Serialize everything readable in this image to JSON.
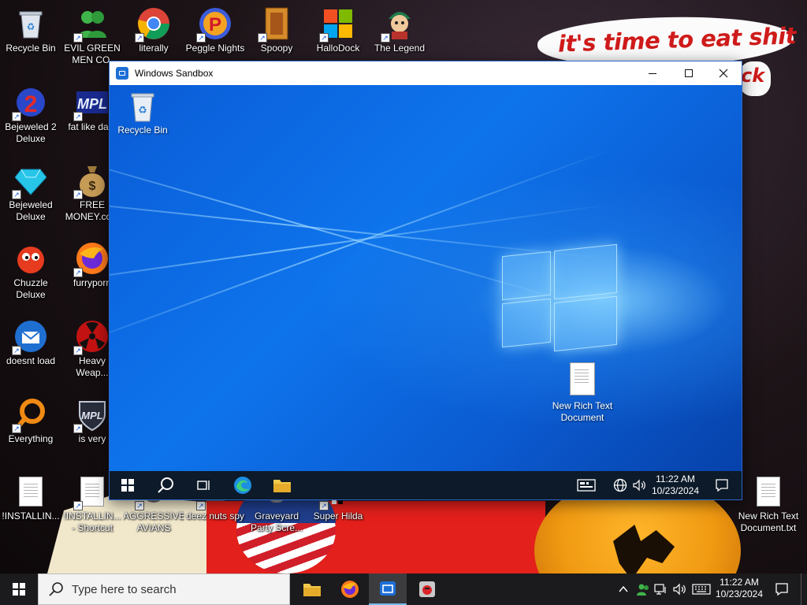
{
  "wallpaper": {
    "sign_text": "it's time to eat shit",
    "sign_text_2": "ck"
  },
  "desktop_icons": [
    {
      "label": "Recycle Bin",
      "icon": "recycle-bin-icon"
    },
    {
      "label": "EVIL GREEN MEN CO.",
      "icon": "evil-green-men-icon"
    },
    {
      "label": "literally",
      "icon": "chrome-icon"
    },
    {
      "label": "Peggle Nights",
      "icon": "peggle-icon"
    },
    {
      "label": "Spoopy",
      "icon": "spoopy-icon"
    },
    {
      "label": "HalloDock",
      "icon": "hallodock-icon"
    },
    {
      "label": "The Legend",
      "icon": "the-legend-icon"
    },
    {
      "label": "Bejeweled 2 Deluxe",
      "icon": "bejeweled-2-icon"
    },
    {
      "label": "fat like dark",
      "icon": "mpl-icon"
    },
    {
      "label": "Bejeweled Deluxe",
      "icon": "bejeweled-icon"
    },
    {
      "label": "FREE MONEY.com",
      "icon": "money-bag-icon"
    },
    {
      "label": "Chuzzle Deluxe",
      "icon": "chuzzle-icon"
    },
    {
      "label": "furryporn",
      "icon": "firefox-icon"
    },
    {
      "label": "doesnt load",
      "icon": "thunderbird-icon"
    },
    {
      "label": "Heavy Weap...",
      "icon": "radiation-icon"
    },
    {
      "label": "Everything",
      "icon": "everything-search-icon"
    },
    {
      "label": "is very",
      "icon": "shield-icon"
    },
    {
      "label": "!INSTALLIN...",
      "icon": "text-document-icon"
    },
    {
      "label": "!INSTALLIN... - Shortcut",
      "icon": "text-document-icon"
    },
    {
      "label": "AGGRESSIVE AVIANS",
      "icon": "aggressive-avians-icon"
    },
    {
      "label": "deez nuts spy",
      "icon": "spy-icon"
    },
    {
      "label": "Graveyard Party Scre...",
      "icon": "graveyard-icon"
    },
    {
      "label": "Super Hilda",
      "icon": "super-hilda-icon"
    },
    {
      "label": "New Rich Text Document.txt",
      "icon": "text-document-icon"
    }
  ],
  "sandbox_window": {
    "title": "Windows Sandbox",
    "desktop_icons": [
      {
        "label": "Recycle Bin",
        "icon": "recycle-bin-icon"
      },
      {
        "label": "New Rich Text Document",
        "icon": "text-document-icon"
      }
    ],
    "taskbar": {
      "time": "11:22 AM",
      "date": "10/23/2024"
    }
  },
  "taskbar": {
    "search_placeholder": "Type here to search",
    "time": "11:22 AM",
    "date": "10/23/2024"
  },
  "colors": {
    "sandbox_accent": "#0e74ec",
    "taskbar": "#1b1a1c",
    "sign_text": "#cf1b1b"
  }
}
